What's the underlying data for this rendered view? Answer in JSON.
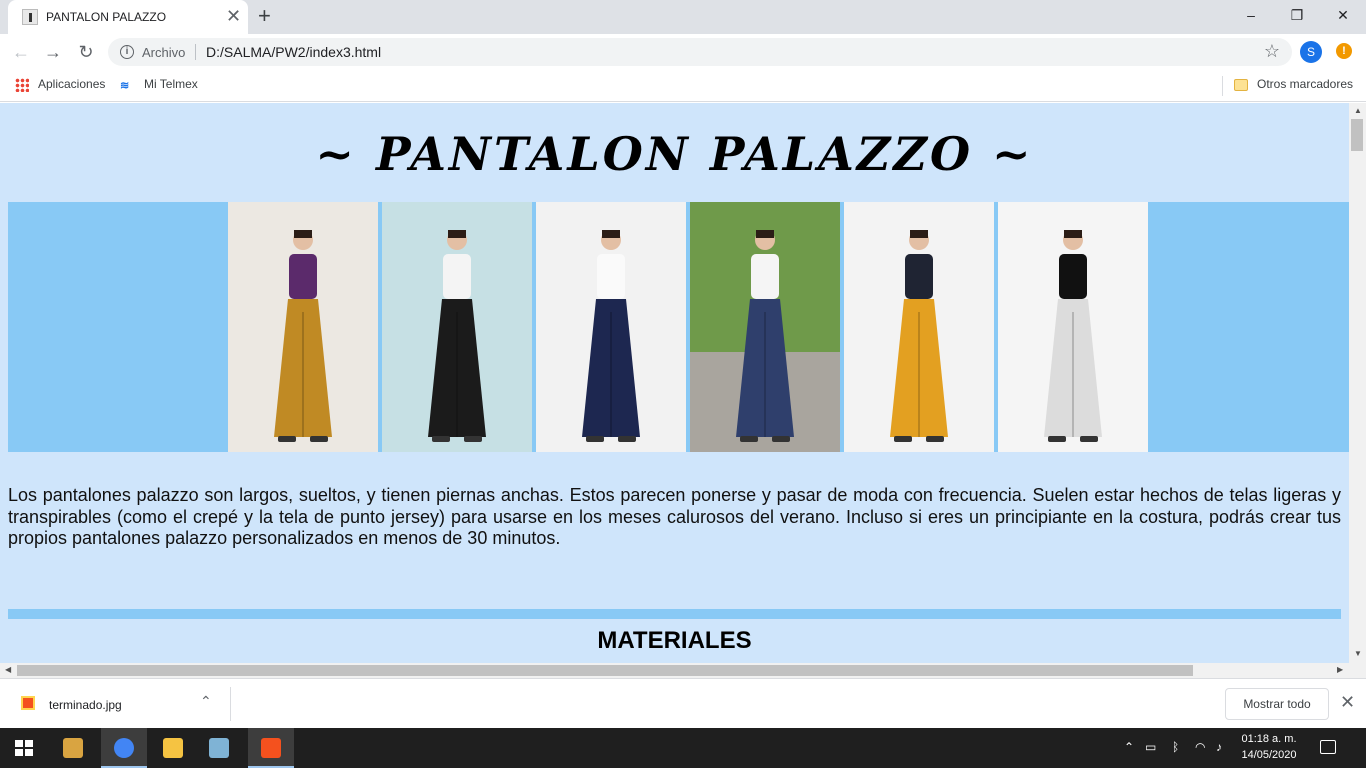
{
  "browser": {
    "tab_title": "PANTALON PALAZZO",
    "tab_close": "✕",
    "new_tab": "+",
    "window": {
      "minimize": "–",
      "maximize": "❐",
      "close": "✕"
    },
    "nav": {
      "back": "←",
      "forward": "→",
      "reload": "↻"
    },
    "omnibox": {
      "security_label": "Archivo",
      "url": "D:/SALMA/PW2/index3.html"
    },
    "profile_initial": "S",
    "alert": "!"
  },
  "bookmarks": {
    "apps": "Aplicaciones",
    "telmex": "Mi Telmex",
    "other": "Otros marcadores"
  },
  "page": {
    "title": "~ PANTALON PALAZZO ~",
    "description": "Los pantalones palazzo son largos, sueltos, y tienen piernas anchas. Estos parecen ponerse y pasar de moda con frecuencia. Suelen estar hechos de telas ligeras y transpirables (como el crepé y la tela de punto jersey) para usarse en los meses calurosos del verano. Incluso si eres un principiante en la costura, podrás crear tus propios pantalones palazzo personalizados en menos de 30 minutos.",
    "section_title": "MATERIALES",
    "gallery": [
      {
        "name": "purple-top-mustard-palazzo",
        "bg": "#ece8e2",
        "top": "#5b2a6b",
        "pants": "#c08a24"
      },
      {
        "name": "white-top-black-palazzo",
        "bg": "#c6e0e4",
        "top": "#f4f4f4",
        "pants": "#1b1b1b"
      },
      {
        "name": "white-top-print-palazzo",
        "bg": "#f2f2f2",
        "top": "#fafafa",
        "pants": "#1d2750"
      },
      {
        "name": "crop-top-stripe-palazzo",
        "bg": "#6f9a4a",
        "top": "#f5f5f5",
        "pants": "#2f3f6c"
      },
      {
        "name": "black-top-mustard-palazzo",
        "bg": "#f3f3f3",
        "top": "#1f2433",
        "pants": "#e3a021"
      },
      {
        "name": "black-top-floral-palazzo",
        "bg": "#f5f5f5",
        "top": "#111111",
        "pants": "#dcdcdc"
      }
    ]
  },
  "downloads": {
    "file_name": "terminado.jpg",
    "chevron": "⌃",
    "show_all": "Mostrar todo",
    "close": "✕"
  },
  "taskbar": {
    "time": "01:18 a. m.",
    "date": "14/05/2020",
    "apps": [
      {
        "name": "media-player",
        "color": "#d9a441"
      },
      {
        "name": "chrome",
        "color": "#4285f4"
      },
      {
        "name": "file-explorer",
        "color": "#f5c342"
      },
      {
        "name": "notepad-app",
        "color": "#7fb3d5"
      },
      {
        "name": "paint-app",
        "color": "#f4511e"
      }
    ]
  }
}
